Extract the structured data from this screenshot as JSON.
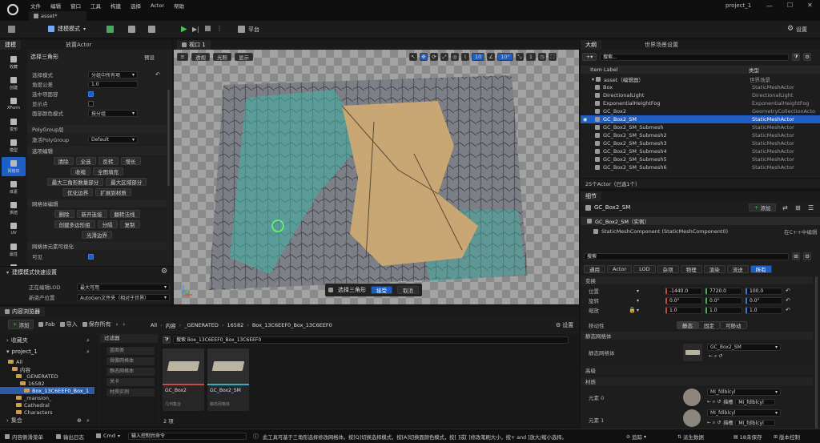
{
  "title_bar": {
    "tab": "asset*",
    "project": "project_1",
    "menu": [
      "文件",
      "编辑",
      "窗口",
      "工具",
      "构建",
      "选择",
      "Actor",
      "帮助"
    ]
  },
  "toolbar": {
    "mode": "建模模式",
    "platform": "平台",
    "settings": "设置"
  },
  "left_tabs": {
    "modeling": "建模",
    "place": "放置Actor"
  },
  "mode_icons": [
    "收藏",
    "创建",
    "XForm",
    "变形",
    "模型",
    "网格体",
    "体素",
    "烘焙",
    "UV",
    "属性",
    "杂项"
  ],
  "tool_panel": {
    "title": "选择三角形",
    "preset": "预设",
    "props": [
      {
        "label": "选择模式",
        "value": "分组中所有项"
      },
      {
        "label": "角度公差",
        "value": "1.0"
      },
      {
        "label": "选中项面容",
        "check": true
      },
      {
        "label": "显示点",
        "check": false
      },
      {
        "label": "面部颜色模式",
        "value": "按分组"
      }
    ],
    "polygroup_header": "PolyGroup层",
    "polygroup_label": "激活PolyGroup",
    "polygroup_value": "Default",
    "select_edit_header": "选项编辑",
    "select_buttons": [
      [
        "清除",
        "全选",
        "反转",
        "增长"
      ],
      [
        "收缩",
        "全图填充"
      ],
      [
        "最大三角形数量部分",
        "最大区域部分"
      ],
      [
        "优化边界",
        "扩展到材质"
      ]
    ],
    "mesh_edit_header": "网格体编辑",
    "mesh_buttons": [
      [
        "删除",
        "新开连接",
        "翻转法线"
      ],
      [
        "创建多边形组",
        "分隔",
        "复制"
      ],
      [
        "光滑边界"
      ]
    ],
    "visualization_header": "网格体元素可视化",
    "visible_label": "可见",
    "quick_settings": "建模模式快速设置",
    "lod_label": "正在编辑LOD",
    "lod_value": "最大可用",
    "asset_loc_label": "新资产位置",
    "asset_loc_value": "AutoGen文件夹（相对于世界）"
  },
  "viewport": {
    "tab": "视口 1",
    "view_btns": [
      "透视",
      "光照",
      "显示"
    ],
    "grid": "10",
    "angle": "10°",
    "scale": "1",
    "overlay_label": "选择三角形",
    "accept": "接受",
    "cancel": "取消"
  },
  "outliner": {
    "tab": "大纲",
    "tab2": "世界场景设置",
    "search_placeholder": "搜索...",
    "col_label": "Item Label",
    "col_type": "类型",
    "rows": [
      {
        "label": "asset（编辑器）",
        "type": "世界场景",
        "depth": 0
      },
      {
        "label": "Box",
        "type": "StaticMeshActor",
        "depth": 1
      },
      {
        "label": "DirectionalLight",
        "type": "DirectionalLight",
        "depth": 1
      },
      {
        "label": "ExponentialHeightFog",
        "type": "ExponentialHeightFog",
        "depth": 1
      },
      {
        "label": "GC_Box2",
        "type": "GeometryCollectionActo",
        "depth": 1
      },
      {
        "label": "GC_Box2_SM",
        "type": "StaticMeshActor",
        "depth": 1,
        "selected": true
      },
      {
        "label": "GC_Box2_SM_Submesh",
        "type": "StaticMeshActor",
        "depth": 1
      },
      {
        "label": "GC_Box2_SM_Submesh2",
        "type": "StaticMeshActor",
        "depth": 1
      },
      {
        "label": "GC_Box2_SM_Submesh3",
        "type": "StaticMeshActor",
        "depth": 1
      },
      {
        "label": "GC_Box2_SM_Submesh4",
        "type": "StaticMeshActor",
        "depth": 1
      },
      {
        "label": "GC_Box2_SM_Submesh5",
        "type": "StaticMeshActor",
        "depth": 1
      },
      {
        "label": "GC_Box2_SM_Submesh6",
        "type": "StaticMeshActor",
        "depth": 1
      }
    ],
    "footer": "25个Actor（已选1个）"
  },
  "details": {
    "tab": "细节",
    "actor": "GC_Box2_SM",
    "add": "添加",
    "instance": "GC_Box2_SM（实例）",
    "component": "StaticMeshComponent (StaticMeshComponent0)",
    "cpp": "在C++中编辑",
    "search_placeholder": "搜索",
    "filters": [
      "通用",
      "Actor",
      "LOD",
      "杂项",
      "物理",
      "渲染",
      "流送",
      "所有"
    ],
    "transform_header": "变换",
    "location_label": "位置",
    "location": [
      "-1440.0",
      "7720.0",
      "100.0"
    ],
    "rotation_label": "旋转",
    "rotation": [
      "0.0°",
      "0.0°",
      "0.0°"
    ],
    "scale_label": "缩放",
    "scale": [
      "1.0",
      "1.0",
      "1.0"
    ],
    "mobility_label": "移动性",
    "mobility": [
      "静态",
      "固定",
      "可移动"
    ],
    "mesh_header": "静态网格体",
    "mesh_label": "静态网格体",
    "mesh_value": "GC_Box2_SM",
    "advanced": "高级",
    "materials_header": "材质",
    "element0_label": "元素 0",
    "element0_value": "MI_fdlblcyl",
    "element0_sub": "MI_fdlblcyl",
    "element1_label": "元素 1",
    "element1_value": "MI_fdlblcyl",
    "element1_sub": "MI_fdlblcyl",
    "sub_label": "描槽"
  },
  "content_browser": {
    "tab": "内容浏览器",
    "add": "添加",
    "fab": "Fab",
    "import": "导入",
    "save_all": "保存所有",
    "path": [
      "All",
      "内容",
      "_GENERATED",
      "16582",
      "Box_13C6EEF0_Box_13C6EEF0"
    ],
    "settings": "设置",
    "favorites": "收藏夹",
    "project": "project_1",
    "tree": [
      "All",
      "内容",
      "_GENERATED",
      "16582",
      "Box_13C6EEF0_Box_1",
      "_mansion_",
      "Cathedral",
      "Characters"
    ],
    "collections": "集合",
    "filter_header": "过滤器",
    "filters": [
      "蓝图类",
      "骨骼网格体",
      "静态网格体",
      "关卡",
      "材质实例"
    ],
    "search_placeholder": "搜索 Box_13C6EEF0_Box_13C6EEF0",
    "assets": [
      {
        "name": "GC_Box2",
        "sub": "几何集合"
      },
      {
        "name": "GC_Box2_SM",
        "sub": "静态网格体"
      }
    ],
    "count": "2 项"
  },
  "status": {
    "drawer": "内容侧滑菜单",
    "log": "输出日志",
    "cmd": "Cmd",
    "cmd_placeholder": "输入控制台命令",
    "hint": "此工具可基于三角形选择修改网格体。按[Q]切换选择模式，按[A]切换面颜色模式，按[ ]或[ ]修改笔刷大小，按+ and ]放大/缩小选择。",
    "trace": "追踪",
    "derived": "派生数据",
    "unsaved": "18未保存",
    "source": "版本控制"
  }
}
